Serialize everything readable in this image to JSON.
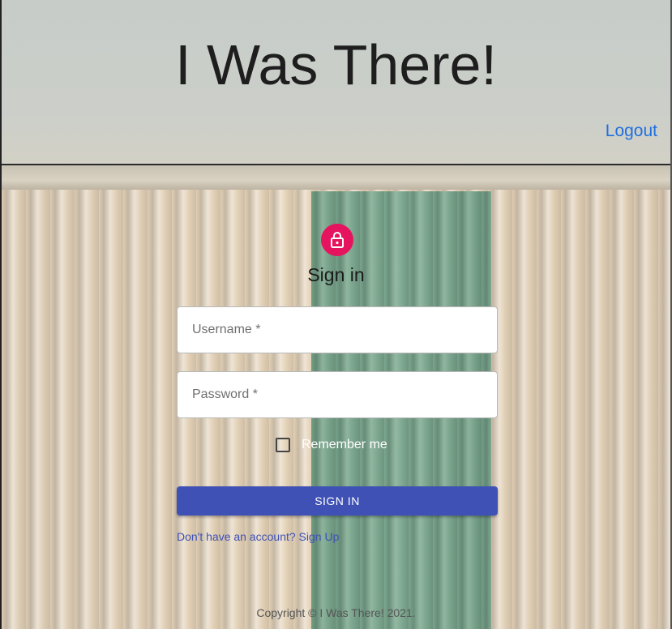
{
  "header": {
    "title": "I Was There!",
    "logout_label": "Logout"
  },
  "form": {
    "lock_icon": "lock-icon",
    "heading": "Sign in",
    "username_placeholder": "Username *",
    "password_placeholder": "Password *",
    "remember_label": "Remember me",
    "remember_checked": false,
    "submit_label": "SIGN IN",
    "signup_link": "Don't have an account? Sign Up"
  },
  "footer": {
    "copyright": "Copyright © I Was There! 2021."
  },
  "colors": {
    "accent": "#3f51b5",
    "avatar": "#e6135e",
    "link": "#1f6fe0"
  }
}
